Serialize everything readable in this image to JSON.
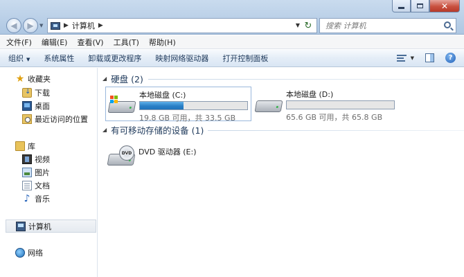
{
  "window": {
    "address": {
      "crumb": "计算机"
    },
    "search": {
      "placeholder": "搜索 计算机"
    }
  },
  "menu": [
    "文件(F)",
    "编辑(E)",
    "查看(V)",
    "工具(T)",
    "帮助(H)"
  ],
  "toolbar": {
    "organize": "组织",
    "system_properties": "系统属性",
    "uninstall": "卸载或更改程序",
    "map_drive": "映射网络驱动器",
    "control_panel": "打开控制面板"
  },
  "sidebar": {
    "favorites": {
      "label": "收藏夹",
      "items": [
        "下载",
        "桌面",
        "最近访问的位置"
      ]
    },
    "libraries": {
      "label": "库",
      "items": [
        "视频",
        "图片",
        "文档",
        "音乐"
      ]
    },
    "computer": "计算机",
    "network": "网络"
  },
  "content": {
    "hard_drives": {
      "header": "硬盘 (2)",
      "drives": [
        {
          "name": "本地磁盘 (C:)",
          "space": "19.8 GB 可用，共 33.5 GB",
          "used_fraction": 0.409
        },
        {
          "name": "本地磁盘 (D:)",
          "space": "65.6 GB 可用，共 65.8 GB",
          "used_fraction": 0.003
        }
      ]
    },
    "removable": {
      "header": "有可移动存储的设备 (1)",
      "devices": [
        {
          "name": "DVD 驱动器 (E:)",
          "badge": "DVD"
        }
      ]
    }
  },
  "colors": {
    "accent": "#1e395b",
    "progress": "#2a7fc6"
  }
}
